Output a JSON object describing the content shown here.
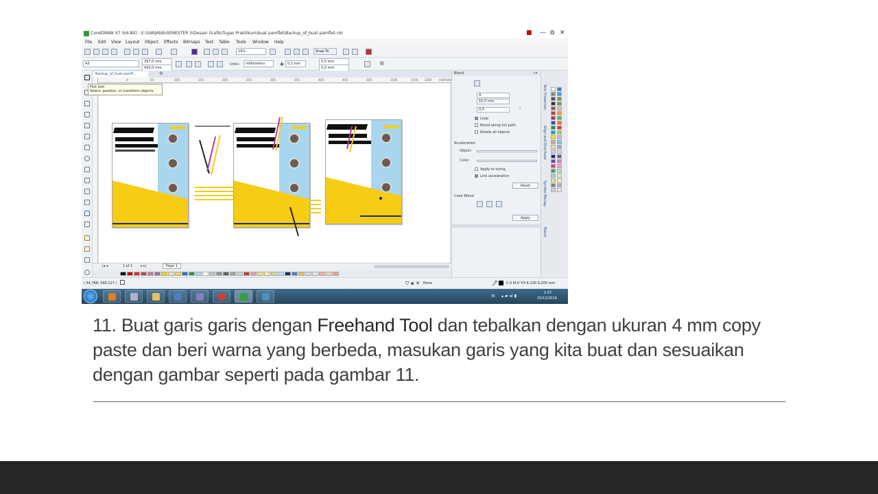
{
  "app": {
    "title": "CorelDRAW X7 (64-Bit) - E:\\SARJANA\\SEMESTER 5\\Desain Grafis\\Tugas Praktikum\\buat pamflet\\Backup_of_buat pamflet.cdr",
    "window_controls": [
      "■",
      "—",
      "⧉",
      "✕"
    ]
  },
  "menu": [
    "File",
    "Edit",
    "View",
    "Layout",
    "Object",
    "Effects",
    "Bitmaps",
    "Text",
    "Table",
    "Tools",
    "Window",
    "Help"
  ],
  "toolbar": {
    "zoom": "19%",
    "snap_to": "Snap To"
  },
  "propbar": {
    "preset": "A3",
    "width": "297,0 mm",
    "height": "420,0 mm",
    "units_label": "Units:",
    "units": "millimeters",
    "nudge": "0,1 mm",
    "dup_x": "5,0 mm",
    "dup_y": "5,0 mm"
  },
  "document": {
    "tab": "Backup_of_buat pamfl...",
    "ruler_ticks": [
      "0",
      "50",
      "100",
      "150",
      "200",
      "250",
      "300",
      "350",
      "400",
      "450",
      "500",
      "1100",
      "1150",
      "1200",
      "millimeters"
    ],
    "page_nav": "1 of 1",
    "page_tab": "Page 1"
  },
  "tooltip": {
    "title": "Pick tool",
    "desc": "Select, position, or transform objects."
  },
  "blend_panel": {
    "title": "Blend",
    "steps": "4",
    "spacing": "10,0 mm",
    "rotation": "0,0",
    "rotation_unit": "°",
    "options": [
      {
        "label": "Loop",
        "checked": true
      },
      {
        "label": "Blend along full path",
        "checked": false
      },
      {
        "label": "Rotate all objects",
        "checked": false
      }
    ],
    "acceleration_title": "Acceleration",
    "object_label": "Object:",
    "color_label": "Color:",
    "accel_options": [
      {
        "label": "Apply to sizing",
        "checked": false
      },
      {
        "label": "Link acceleration",
        "checked": true
      }
    ],
    "reset": "Reset",
    "color_blend_title": "Color Blend",
    "apply": "Apply"
  },
  "side_tabs": [
    "Text Properties",
    "Align and Distribute",
    "Symbol Manag...",
    "Blend"
  ],
  "status": {
    "coords": "( 54,768; 549,127 )",
    "fill_label": "None",
    "outline": "C:0 M:0 Y:0 K:100  0,200 mm"
  },
  "tray": {
    "lang": "IN",
    "time": "1:57",
    "date": "25/12/2018"
  },
  "colors": {
    "accent_yellow": "#f7cc14",
    "accent_blue": "#a8d6ee",
    "navy": "#1a2a6e",
    "footer": "#262626"
  },
  "caption": {
    "pre": "11. Buat garis garis dengan ",
    "highlight": "Freehand Tool",
    "post": " dan tebalkan dengan ukuran 4 mm copy paste dan beri warna yang berbeda, masukan garis yang kita buat dan sesuaikan dengan gambar seperti pada gambar 11."
  }
}
